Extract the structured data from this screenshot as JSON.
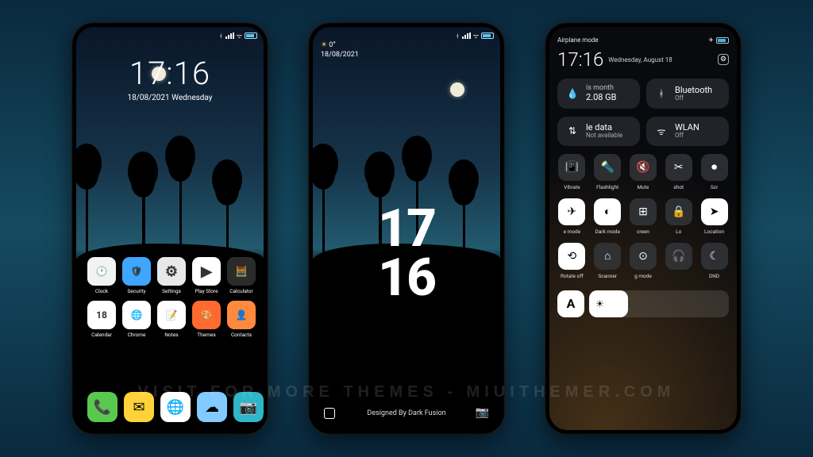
{
  "watermark": "VISIT FOR MORE THEMES - MIUITHEMER.COM",
  "home": {
    "time": "17:16",
    "date": "18/08/2021 Wednesday",
    "apps_row1": [
      {
        "label": "Clock",
        "bg": "#f2f2f2",
        "glyph": "🕐"
      },
      {
        "label": "Security",
        "bg": "#3fa6ff",
        "glyph": "🛡"
      },
      {
        "label": "Settings",
        "bg": "#e8e8e8",
        "glyph": "⚙"
      },
      {
        "label": "Play Store",
        "bg": "#ffffff",
        "glyph": "▶"
      },
      {
        "label": "Calculator",
        "bg": "#2b2b2b",
        "glyph": "🧮"
      }
    ],
    "apps_row2": [
      {
        "label": "Calendar",
        "bg": "#ffffff",
        "glyph": "18"
      },
      {
        "label": "Chrome",
        "bg": "#ffffff",
        "glyph": "🌐"
      },
      {
        "label": "Notes",
        "bg": "#ffffff",
        "glyph": "📝"
      },
      {
        "label": "Themes",
        "bg": "#ff6a2f",
        "glyph": "🎨"
      },
      {
        "label": "Contacts",
        "bg": "#ff8a3d",
        "glyph": "👤"
      }
    ],
    "dock": [
      {
        "name": "phone",
        "bg": "#58c94e",
        "glyph": "📞"
      },
      {
        "name": "messages",
        "bg": "#ffd23a",
        "glyph": "✉"
      },
      {
        "name": "browser",
        "bg": "#ffffff",
        "glyph": "🌐"
      },
      {
        "name": "weather",
        "bg": "#82caff",
        "glyph": "☁"
      },
      {
        "name": "camera",
        "bg": "#2fb6c8",
        "glyph": "📷"
      }
    ]
  },
  "lock": {
    "weather_temp": "0°",
    "date": "18/08/2021",
    "hour": "17",
    "minute": "16",
    "credit": "Designed By Dark Fusion"
  },
  "cc": {
    "status_label": "Airplane mode",
    "time": "17:16",
    "date": "Wednesday, August 18",
    "tiles_wide": [
      {
        "icon": "💧",
        "top": "is month",
        "main": "2.08 GB",
        "sub": "",
        "color": "#3da8ff"
      },
      {
        "icon": "ᚼ",
        "top": "",
        "main": "Bluetooth",
        "sub": "Off",
        "color": "#fff"
      },
      {
        "icon": "⇅",
        "top": "",
        "main": "le data",
        "sub": "Not available",
        "color": "#fff"
      },
      {
        "icon": "ᯤ",
        "top": "",
        "main": "WLAN",
        "sub": "Off",
        "color": "#fff"
      }
    ],
    "quick1": [
      {
        "label": "Vibrate",
        "glyph": "📳",
        "on": false
      },
      {
        "label": "Flashlight",
        "glyph": "🔦",
        "on": false
      },
      {
        "label": "Mute",
        "glyph": "🔇",
        "on": false
      },
      {
        "label": "shot",
        "glyph": "✂",
        "on": false
      },
      {
        "label": "Scr",
        "glyph": "⏺",
        "on": false
      }
    ],
    "quick2": [
      {
        "label": "e mode",
        "glyph": "✈",
        "on": true
      },
      {
        "label": "Dark mode",
        "glyph": "◐",
        "on": true
      },
      {
        "label": "creen",
        "glyph": "⊞",
        "on": false
      },
      {
        "label": "Lo",
        "glyph": "🔒",
        "on": false
      },
      {
        "label": "Location",
        "glyph": "➤",
        "on": true
      }
    ],
    "quick3": [
      {
        "label": "Rotate off",
        "glyph": "⟲",
        "on": true
      },
      {
        "label": "Scanner",
        "glyph": "⌂",
        "on": false
      },
      {
        "label": "g mode",
        "glyph": "⊙",
        "on": false
      },
      {
        "label": "",
        "glyph": "🎧",
        "on": false
      },
      {
        "label": "DND",
        "glyph": "☾",
        "on": false
      }
    ],
    "auto_label": "A"
  }
}
